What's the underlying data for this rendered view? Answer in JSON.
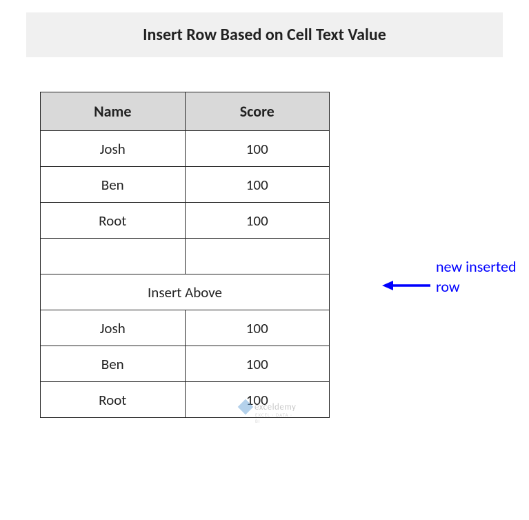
{
  "title": "Insert Row Based on Cell Text Value",
  "table": {
    "headers": {
      "name": "Name",
      "score": "Score"
    },
    "rows": [
      {
        "name": "Josh",
        "score": "100"
      },
      {
        "name": "Ben",
        "score": "100"
      },
      {
        "name": "Root",
        "score": "100"
      },
      {
        "name": "",
        "score": ""
      },
      {
        "merged": "Insert Above"
      },
      {
        "name": "Josh",
        "score": "100"
      },
      {
        "name": "Ben",
        "score": "100"
      },
      {
        "name": "Root",
        "score": "100"
      }
    ]
  },
  "annotation": {
    "text": "new inserted row"
  },
  "watermark": {
    "brand": "exceldemy",
    "tagline": "EXCEL · DATA · BI"
  }
}
